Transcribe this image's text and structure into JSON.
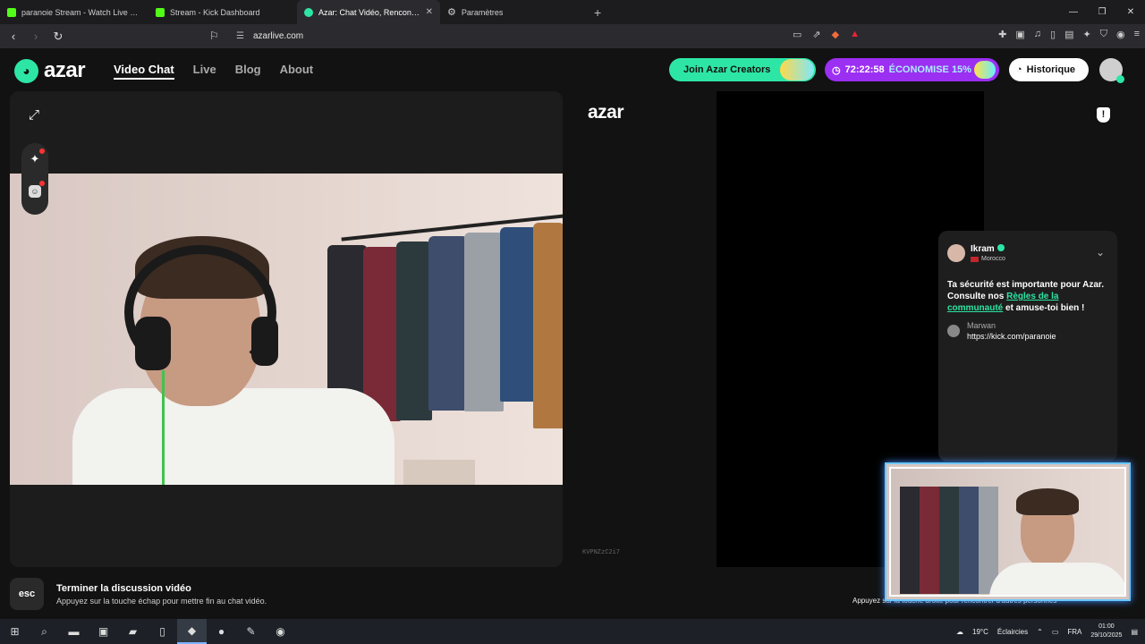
{
  "browser": {
    "tabs": [
      {
        "label": "paranoie Stream - Watch Live on Kick",
        "icon": "kick-icon"
      },
      {
        "label": "Stream - Kick Dashboard",
        "icon": "kick-icon"
      },
      {
        "label": "Azar: Chat Vidéo, Rencontre",
        "icon": "azar-icon"
      },
      {
        "label": "Paramètres",
        "icon": "gear-icon"
      }
    ],
    "url": "azarlive.com"
  },
  "site": {
    "logo": "azar",
    "nav": [
      "Video Chat",
      "Live",
      "Blog",
      "About"
    ],
    "creators_button": "Join Azar Creators",
    "timer": "72:22:58",
    "promo": "ÉCONOMISE 15%",
    "history_button": "Historique"
  },
  "left_panel": {
    "end_title": "Terminer la discussion vidéo",
    "end_sub": "Appuyez sur la touche échap pour mettre fin au chat vidéo.",
    "esc_key": "esc"
  },
  "right_panel": {
    "logo": "azar",
    "code": "KVPNZzC2i7",
    "hint": "Appuyez sur la touche droite pour rencontrer d'autres personnes"
  },
  "chat": {
    "name": "Ikram",
    "country": "Morocco",
    "safety_pre": "Ta sécurité est importante pour Azar. Consulte nos ",
    "safety_link": "Règles de la communauté",
    "safety_post": " et amuse-toi bien !",
    "message_author": "Marwan",
    "message_text": "https://kick.com/paranoie"
  },
  "taskbar": {
    "weather": "19°C",
    "weather_desc": "Éclaircies",
    "lang": "FRA",
    "time": "01:00",
    "date": "29/10/2025"
  },
  "colors": {
    "accent": "#2de6a5",
    "promo": "#9b2ff2",
    "pip_glow": "#6ac8ff"
  }
}
